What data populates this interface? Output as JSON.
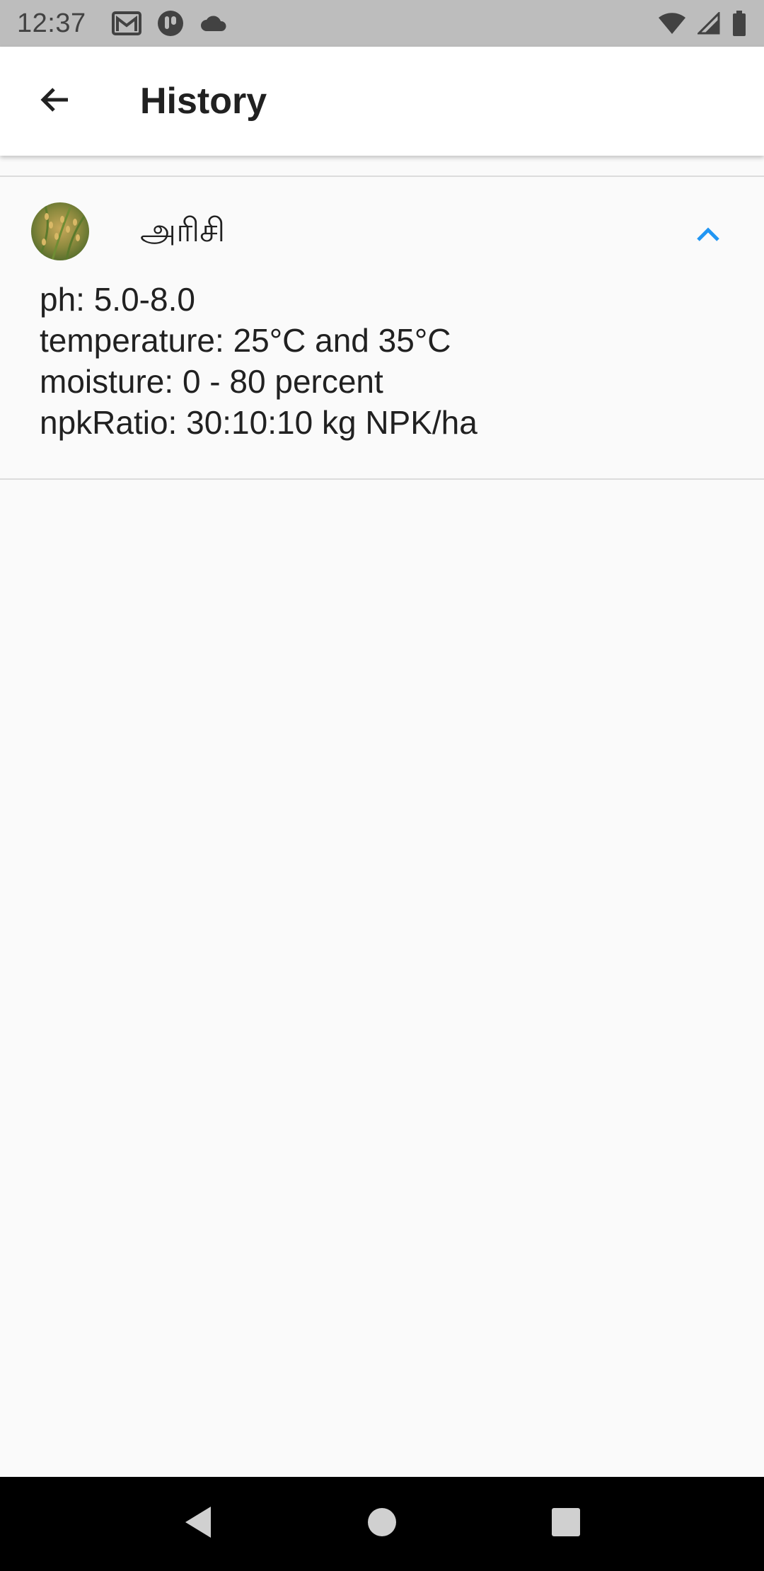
{
  "status_bar": {
    "time": "12:37",
    "left_icons": [
      "gmail-icon",
      "app-notification-icon",
      "cloud-icon"
    ],
    "right_icons": [
      "wifi-icon",
      "cell-signal-icon",
      "battery-icon"
    ]
  },
  "app_bar": {
    "back_icon": "arrow-back-icon",
    "title": "History"
  },
  "history": {
    "items": [
      {
        "crop_name": "அரிசி",
        "avatar": "rice-plant-image",
        "expanded_icon": "chevron-up-icon",
        "details": [
          "ph: 5.0-8.0",
          "temperature: 25°C and 35°C",
          "moisture: 0 - 80 percent",
          "npkRatio: 30:10:10 kg NPK/ha"
        ]
      }
    ]
  },
  "nav_bar": {
    "buttons": [
      "back-triangle-icon",
      "home-circle-icon",
      "recents-square-icon"
    ]
  },
  "colors": {
    "status_bar_bg": "#bdbdbd",
    "app_bar_bg": "#ffffff",
    "page_bg": "#fafafa",
    "accent": "#2196f3",
    "divider": "#dcdcdc",
    "nav_bar_bg": "#000000"
  }
}
